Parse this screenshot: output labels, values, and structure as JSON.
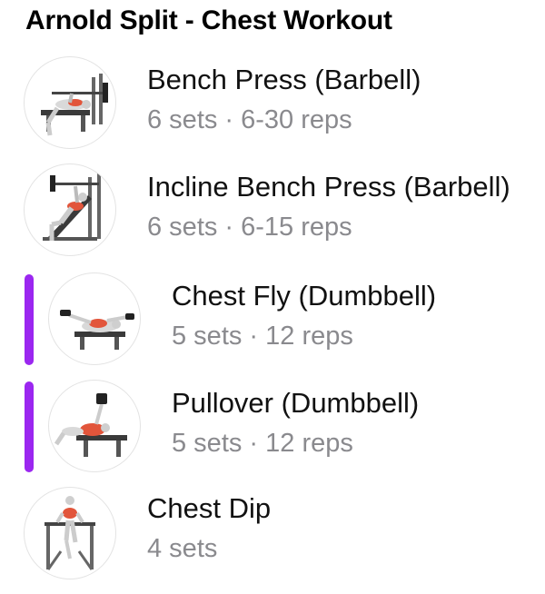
{
  "header": {
    "title": "Arnold Split - Chest Workout"
  },
  "accent_color": "#9b27f0",
  "exercises": [
    {
      "name": "Bench Press (Barbell)",
      "details": "6 sets · 6-30 reps",
      "thumbnail_icon": "bench-press-illustration",
      "grouped": false
    },
    {
      "name": "Incline Bench Press (Barbell)",
      "details": "6 sets · 6-15 reps",
      "thumbnail_icon": "incline-bench-press-illustration",
      "grouped": false
    },
    {
      "name": "Chest Fly (Dumbbell)",
      "details": "5 sets · 12 reps",
      "thumbnail_icon": "chest-fly-illustration",
      "grouped": true
    },
    {
      "name": "Pullover (Dumbbell)",
      "details": "5 sets · 12 reps",
      "thumbnail_icon": "pullover-illustration",
      "grouped": true
    },
    {
      "name": "Chest Dip",
      "details": "4 sets",
      "thumbnail_icon": "chest-dip-illustration",
      "grouped": false
    }
  ]
}
